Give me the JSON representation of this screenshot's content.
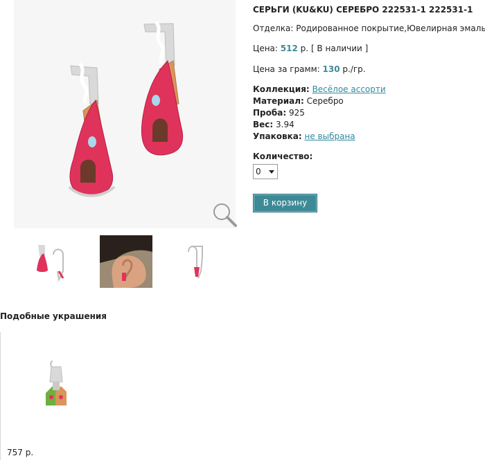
{
  "product": {
    "title": "СЕРЬГИ (KU&KU) СЕРЕБРО 222531-1 222531-1",
    "finish_label": "Отделка:",
    "finish_value": "Родированное покрытие,Ювелирная эмаль",
    "price_label": "Цена:",
    "price_value": "512",
    "price_unit": "р.",
    "availability": "[ В наличии ]",
    "price_per_gram_label": "Цена за грамм:",
    "price_per_gram_value": "130",
    "price_per_gram_unit": "р./гр.",
    "collection_label": "Коллекция:",
    "collection_value": "Весёлое ассорти",
    "material_label": "Материал:",
    "material_value": "Серебро",
    "probe_label": "Проба:",
    "probe_value": "925",
    "weight_label": "Вес:",
    "weight_value": "3.94",
    "packaging_label": "Упаковка:",
    "packaging_value": "не выбрана",
    "quantity_label": "Количество:",
    "quantity_value": "0",
    "cart_button": "В корзину"
  },
  "similar": {
    "title": "Подобные украшения",
    "items": [
      {
        "price": "757 р."
      }
    ]
  },
  "colors": {
    "accent": "#3d8a96",
    "link": "#2f8aa0",
    "enamel_pink": "#e0335c",
    "enamel_orange": "#d9955a"
  }
}
